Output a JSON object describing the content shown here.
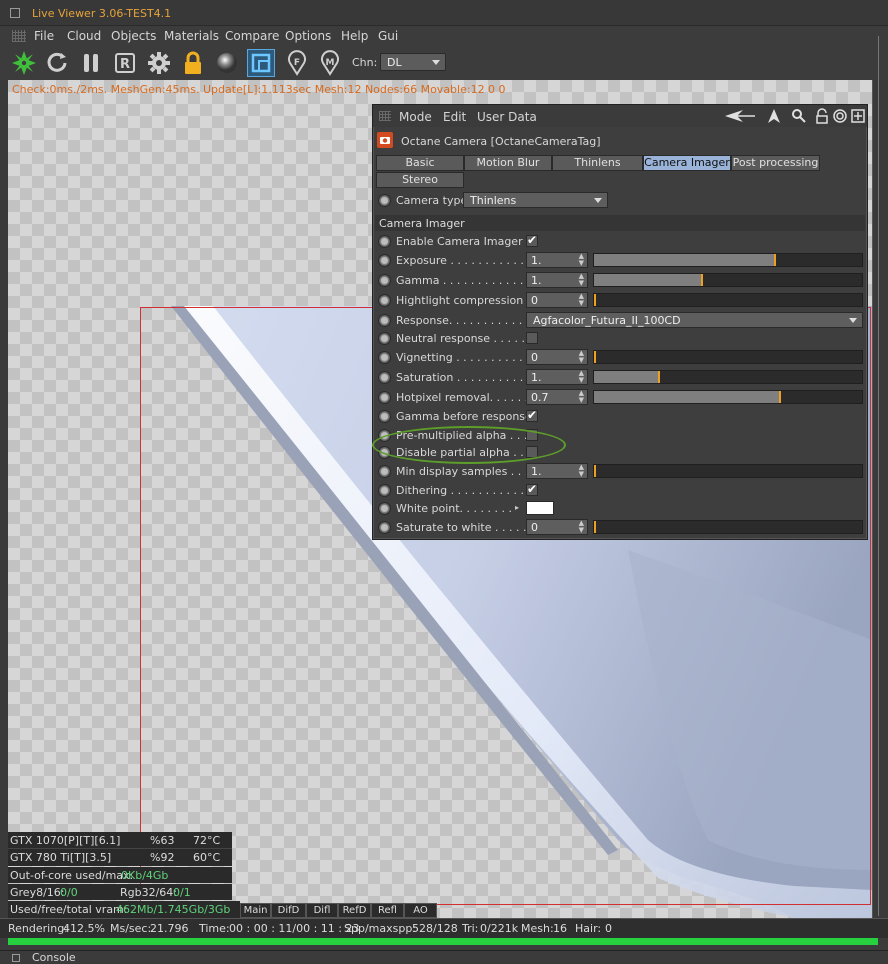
{
  "window": {
    "title": "Live Viewer 3.06-TEST4.1"
  },
  "menu": [
    "File",
    "Cloud",
    "Objects",
    "Materials",
    "Compare",
    "Options",
    "Help",
    "Gui"
  ],
  "toolbar": {
    "channel_label": "Chn:",
    "channel_value": "DL",
    "icons": [
      "octane-logo-icon",
      "refresh-icon",
      "pause-icon",
      "r-icon",
      "gear-icon",
      "lock-icon",
      "sphere-icon",
      "region-icon",
      "pin-f-icon",
      "pin-m-icon"
    ]
  },
  "stats_line": "Check:0ms./2ms. MeshGen:45ms. Update[L]:1.113sec Mesh:12 Nodes:66 Movable:12  0 0",
  "panel": {
    "menu": [
      "Mode",
      "Edit",
      "User Data"
    ],
    "title": "Octane Camera [OctaneCameraTag]",
    "tabs": [
      {
        "label": "Basic",
        "active": false
      },
      {
        "label": "Motion Blur",
        "active": false
      },
      {
        "label": "Thinlens",
        "active": false
      },
      {
        "label": "Camera Imager",
        "active": true
      },
      {
        "label": "Post processing",
        "active": false
      },
      {
        "label": "Stereo",
        "active": false
      }
    ],
    "camera_type": {
      "label": "Camera type",
      "value": "Thinlens"
    },
    "section": "Camera Imager",
    "rows": {
      "enable": {
        "label": "Enable Camera Imager . .",
        "checked": true
      },
      "exposure": {
        "label": "Exposure . . . . . . . . . . . . .",
        "value": "1.",
        "level": 0.67
      },
      "gamma": {
        "label": "Gamma . . . . . . . . . . . . . .",
        "value": "1.",
        "level": 0.4
      },
      "highlight": {
        "label": "Hightlight compression",
        "value": "0",
        "level": 0
      },
      "response": {
        "label": "Response. . . . . . . . . . . . .",
        "value": "Agfacolor_Futura_II_100CD"
      },
      "neutral": {
        "label": "Neutral response . . . . . .",
        "checked": false
      },
      "vignetting": {
        "label": "Vignetting . . . . . . . . . . .",
        "value": "0",
        "level": 0
      },
      "saturation": {
        "label": "Saturation . . . . . . . . . . .",
        "value": "1.",
        "level": 0.24
      },
      "hotpixel": {
        "label": "Hotpixel removal. . . . . . .",
        "value": "0.7",
        "level": 0.69
      },
      "gamma_before": {
        "label": "Gamma before response",
        "checked": true
      },
      "premult": {
        "label": "Pre-multiplied alpha . . . .",
        "checked": false
      },
      "disable_partial": {
        "label": "Disable partial alpha . . .",
        "checked": false
      },
      "min_samples": {
        "label": "Min display samples . . .",
        "value": "1.",
        "level": 0
      },
      "dithering": {
        "label": "Dithering . . . . . . . . . . . .",
        "checked": true
      },
      "white_point": {
        "label": "White point. . . . . . . .",
        "color": "#ffffff"
      },
      "saturate_white": {
        "label": "Saturate to white . . . . .",
        "value": "0",
        "level": 0
      }
    }
  },
  "gpu": [
    {
      "name": "GTX 1070[P][T][6.1]",
      "load": "%63",
      "temp": "72°C"
    },
    {
      "name": "GTX 780 Ti[T][3.5]",
      "load": "%92",
      "temp": "60°C"
    }
  ],
  "memory": {
    "out_of_core_label": "Out-of-core used/max:",
    "out_of_core_value": "0Kb/4Gb",
    "grey_label": "Grey8/16:",
    "grey_value": "0/0",
    "rgb_label": "Rgb32/64:",
    "rgb_value": "0/1",
    "vram_label": "Used/free/total vram:",
    "vram_value": "462Mb/1.745Gb/3Gb"
  },
  "render_tabs": [
    "Main",
    "DifD",
    "Difl",
    "RefD",
    "Refl",
    "AO"
  ],
  "status": {
    "rendering_label": "Rendering:",
    "rendering_value": "412.5%",
    "ms_label": "Ms/sec:",
    "ms_value": "21.796",
    "time_label": "Time:",
    "time_value": "00 : 00 : 11/00 : 11 : 23",
    "spp_label": "Spp/maxspp:",
    "spp_value": "528/128",
    "tri_label": "Tri:",
    "tri_value": "0/221k",
    "mesh_label": "Mesh:",
    "mesh_value": "16",
    "hair_label": "Hair:",
    "hair_value": "0"
  },
  "console": "Console",
  "colors": {
    "accent": "#f0a020",
    "progress": "#26d03e",
    "active_tab": "#9ab3d8",
    "stats": "#d86b1f",
    "highlight_ring": "#5d9d2a"
  }
}
